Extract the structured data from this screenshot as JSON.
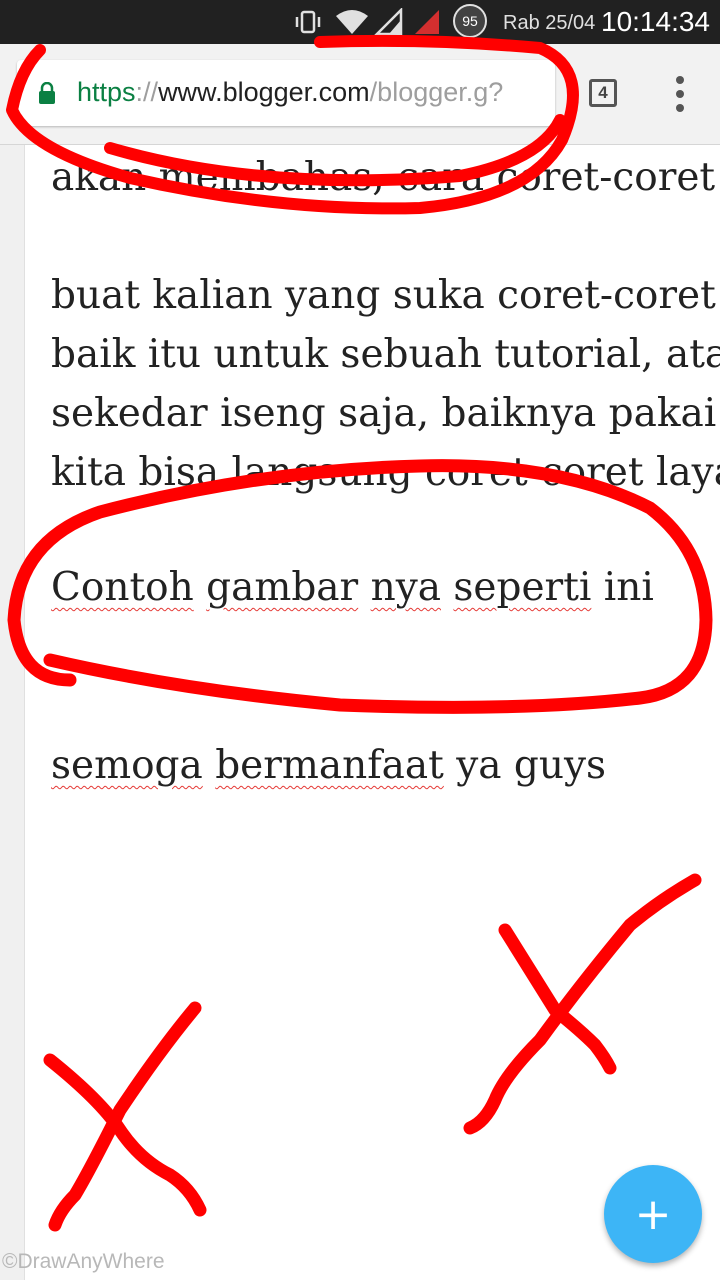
{
  "status_bar": {
    "battery_level": "95",
    "date": "Rab 25/04",
    "time": "10:14:34",
    "icons": [
      "vibrate-icon",
      "wifi-icon",
      "signal-icon",
      "no-signal-icon"
    ]
  },
  "browser": {
    "url_scheme": "https",
    "url_separator": "://",
    "url_host": "www.blogger.com",
    "url_path": "/blogger.g?",
    "tab_count": "4",
    "secure_color": "#0b8043"
  },
  "post": {
    "lines": [
      "akan membahas, cara coret-coret",
      "buat kalian yang suka coret-coret",
      "baik itu untuk sebuah tutorial, atau",
      "sekedar iseng saja, baiknya pakai",
      "kita bisa langsung coret-coret layar",
      "semoga bermanfaat ya guys"
    ],
    "example_line": {
      "word1": "Contoh",
      "word2": "gambar",
      "word3": "nya",
      "word4": "seperti",
      "word5": "ini"
    },
    "closing": {
      "word1": "semoga",
      "word2": "bermanfaat",
      "rest": "ya guys"
    }
  },
  "fab": {
    "label": "+",
    "color": "#3db5f6"
  },
  "watermark": "©DrawAnyWhere",
  "annotation_color": "#ff0000"
}
